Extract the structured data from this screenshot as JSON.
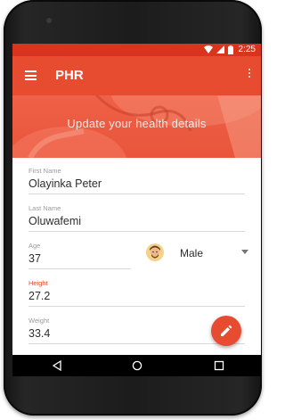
{
  "status_bar": {
    "time": "2:25",
    "background": "#d8341f"
  },
  "app_bar": {
    "title": "PHR",
    "menu_icon": "menu-icon",
    "more_icon": "more-vert-icon",
    "color": "#e84c30"
  },
  "hero": {
    "text": "Update your health details"
  },
  "form": {
    "first_name": {
      "label": "First Name",
      "value": "Olayinka Peter"
    },
    "last_name": {
      "label": "Last Name",
      "value": "Oluwafemi"
    },
    "age": {
      "label": "Age",
      "value": "37"
    },
    "gender": {
      "value": "Male",
      "icon": "avatar-icon"
    },
    "height": {
      "label": "Height",
      "value": "27.2"
    },
    "weight": {
      "label": "Weight",
      "value": "33.4"
    }
  },
  "fab": {
    "icon": "edit-icon"
  },
  "nav": {
    "back": "back-icon",
    "home": "home-icon",
    "recents": "recents-icon"
  }
}
